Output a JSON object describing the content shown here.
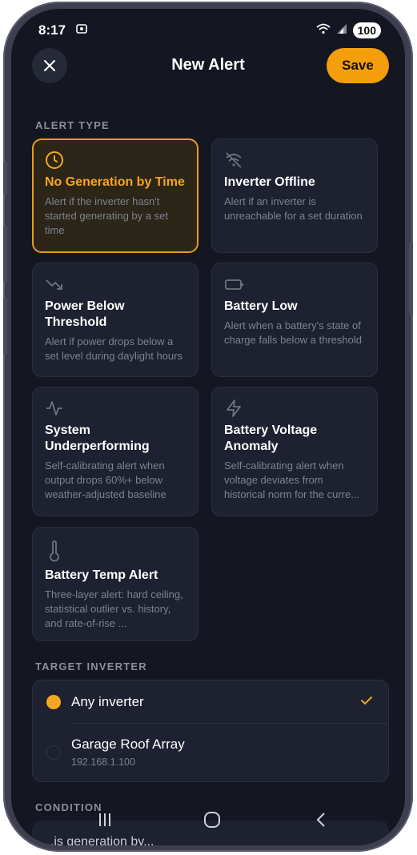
{
  "status": {
    "time": "8:17",
    "battery": "100"
  },
  "header": {
    "title": "New Alert",
    "save_label": "Save"
  },
  "sections": {
    "alert_type": "ALERT TYPE",
    "target_inverter": "TARGET INVERTER",
    "condition": "CONDITION"
  },
  "alert_types": [
    {
      "title": "No Generation by Time",
      "desc": "Alert if the inverter hasn't started generating by a set time",
      "icon": "clock-icon",
      "selected": true
    },
    {
      "title": "Inverter Offline",
      "desc": "Alert if an inverter is unreachable for a set duration",
      "icon": "wifi-off-icon",
      "selected": false
    },
    {
      "title": "Power Below Threshold",
      "desc": "Alert if power drops below a set level during daylight hours",
      "icon": "trending-down-icon",
      "selected": false
    },
    {
      "title": "Battery Low",
      "desc": "Alert when a battery's state of charge falls below a threshold",
      "icon": "battery-icon",
      "selected": false
    },
    {
      "title": "System Underperforming",
      "desc": "Self-calibrating alert when output drops 60%+ below weather-adjusted baseline",
      "icon": "activity-icon",
      "selected": false
    },
    {
      "title": "Battery Voltage Anomaly",
      "desc": "Self-calibrating alert when voltage deviates from historical norm for the curre...",
      "icon": "zap-icon",
      "selected": false
    },
    {
      "title": "Battery Temp Alert",
      "desc": "Three-layer alert: hard ceiling, statistical outlier vs. history, and rate-of-rise ...",
      "icon": "thermometer-icon",
      "selected": false
    }
  ],
  "inverters": [
    {
      "label": "Any inverter",
      "sub": "",
      "selected": true
    },
    {
      "label": "Garage Roof Array",
      "sub": "192.168.1.100",
      "selected": false
    }
  ],
  "condition_preview": "...is generation by...",
  "colors": {
    "accent": "#f59e0b",
    "background": "#141722",
    "card": "#1d2130"
  }
}
